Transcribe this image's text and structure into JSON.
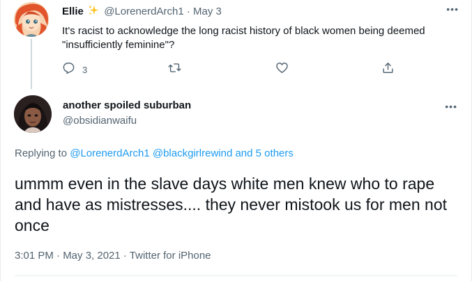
{
  "parent_tweet": {
    "display_name": "Ellie",
    "handle": "@LorenerdArch1",
    "separator": "·",
    "date": "May 3",
    "text": "It's racist to acknowledge the long racist history of black women being deemed \"insufficiently feminine\"?",
    "reply_count": "3",
    "more_label": "•••",
    "icons": [
      "reply-icon",
      "retweet-icon",
      "like-icon",
      "share-icon"
    ]
  },
  "main_tweet": {
    "display_name": "another spoiled suburban",
    "handle": "@obsidianwaifu",
    "more_label": "•••",
    "replying_prefix": "Replying to",
    "replying_to_1": "@LorenerdArch1",
    "replying_to_2": "@blackgirlrewind",
    "replying_and": "and",
    "replying_others": "5 others",
    "text": "ummm even in the slave days white men knew who to rape and have as mistresses.... they never mistook us for men not once",
    "timestamp": "3:01 PM · May 3, 2021 · Twitter for iPhone"
  },
  "colors": {
    "link": "#1d9bf0",
    "secondary_text": "#536471",
    "primary_text": "#0f1419",
    "thread_line": "#cfd9de"
  }
}
